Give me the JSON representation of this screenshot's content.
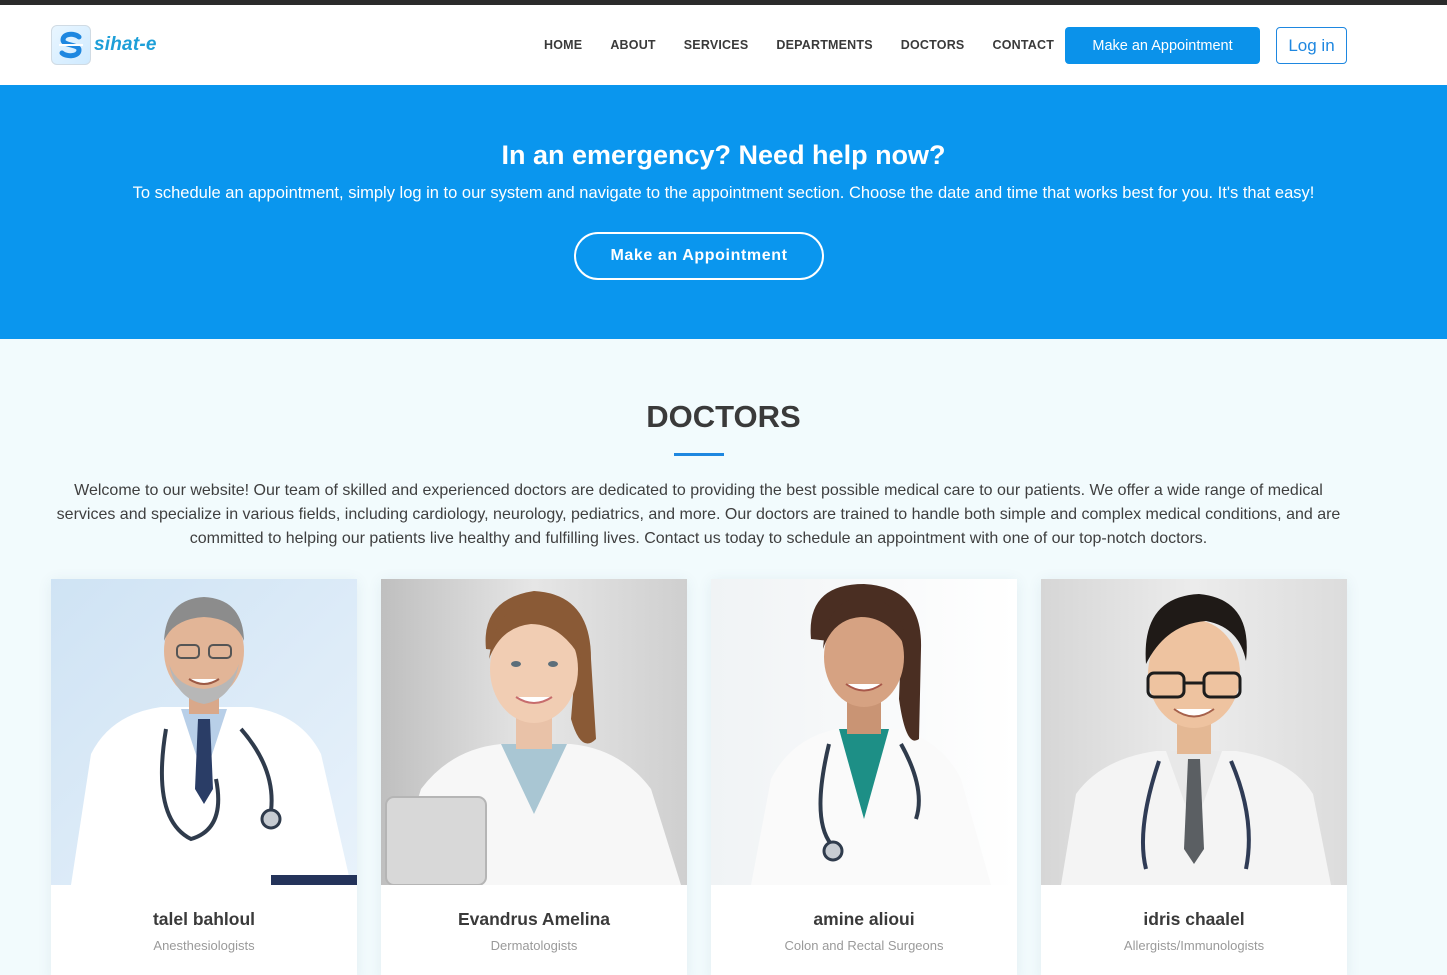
{
  "brand": {
    "name": "sihat-e"
  },
  "nav": {
    "items": [
      {
        "label": "HOME"
      },
      {
        "label": "ABOUT"
      },
      {
        "label": "SERVICES"
      },
      {
        "label": "DEPARTMENTS"
      },
      {
        "label": "DOCTORS"
      },
      {
        "label": "CONTACT"
      }
    ],
    "appointment_label": "Make an Appointment",
    "login_label": "Log in"
  },
  "cta": {
    "title": "In an emergency? Need help now?",
    "text": "To schedule an appointment, simply log in to our system and navigate to the appointment section. Choose the date and time that works best for you. It's that easy!",
    "button_label": "Make an Appointment"
  },
  "doctors": {
    "title": "DOCTORS",
    "intro": "Welcome to our website! Our team of skilled and experienced doctors are dedicated to providing the best possible medical care to our patients. We offer a wide range of medical services and specialize in various fields, including cardiology, neurology, pediatrics, and more. Our doctors are trained to handle both simple and complex medical conditions, and are committed to helping our patients live healthy and fulfilling lives. Contact us today to schedule an appointment with one of our top-notch doctors.",
    "items": [
      {
        "name": "talel bahloul",
        "specialty": "Anesthesiologists",
        "photo": "doctor-photo-male-gray-beard"
      },
      {
        "name": "Evandrus Amelina",
        "specialty": "Dermatologists",
        "photo": "doctor-photo-female-blonde"
      },
      {
        "name": "amine alioui",
        "specialty": "Colon and Rectal Surgeons",
        "photo": "doctor-photo-female-brunette"
      },
      {
        "name": "idris chaalel",
        "specialty": "Allergists/Immunologists",
        "photo": "doctor-photo-male-glasses"
      }
    ]
  },
  "colors": {
    "primary": "#0a96ee",
    "accent": "#1e87e0",
    "section_bg": "#f2fbfd"
  }
}
